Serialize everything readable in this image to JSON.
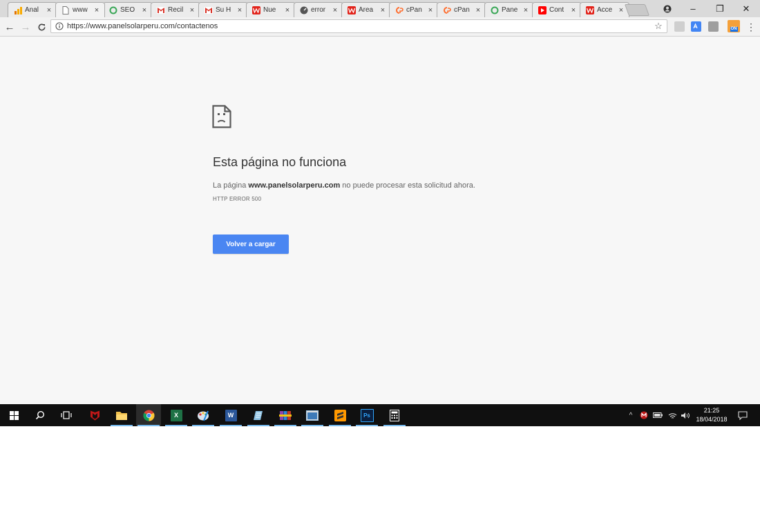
{
  "browser": {
    "tabs": [
      {
        "title": "Anal",
        "favicon": "analytics-icon",
        "color": "#f4b400"
      },
      {
        "title": "www",
        "favicon": "page-icon",
        "color": "#ffffff",
        "active": true
      },
      {
        "title": "SEO",
        "favicon": "green-refresh-icon",
        "color": "#3aa757"
      },
      {
        "title": "Recil",
        "favicon": "gmail-1004-icon",
        "color": "#d93025"
      },
      {
        "title": "Su H",
        "favicon": "gmail-icon",
        "color": "#d93025"
      },
      {
        "title": "Nue",
        "favicon": "w-icon",
        "color": "#e2231a"
      },
      {
        "title": "error",
        "favicon": "gauge-icon",
        "color": "#555555"
      },
      {
        "title": "Área",
        "favicon": "w-icon",
        "color": "#e2231a"
      },
      {
        "title": "cPan",
        "favicon": "cpanel-icon",
        "color": "#ff6c2c"
      },
      {
        "title": "cPan",
        "favicon": "cpanel-icon",
        "color": "#ff6c2c"
      },
      {
        "title": "Pane",
        "favicon": "green-refresh-icon",
        "color": "#3aa757"
      },
      {
        "title": "Cont",
        "favicon": "youtube-icon",
        "color": "#ff0000"
      },
      {
        "title": "Acce",
        "favicon": "w-icon",
        "color": "#e2231a"
      }
    ],
    "tab_close": "×",
    "window_controls": {
      "minimize": "–",
      "restore": "❐",
      "close": "✕"
    },
    "back": "←",
    "forward": "→",
    "reload": "C",
    "url": "https://www.panelsolarperu.com/contactenos",
    "star": "☆",
    "menu": "⋮",
    "extension_badge": "ON"
  },
  "error_page": {
    "heading": "Esta página no funciona",
    "message_prefix": "La página ",
    "domain": "www.panelsolarperu.com",
    "message_suffix": " no puede procesar esta solicitud ahora.",
    "error_code": "HTTP ERROR 500",
    "reload_button": "Volver a cargar"
  },
  "taskbar": {
    "clock_time": "21:25",
    "clock_date": "18/04/2018",
    "excel_letter": "X",
    "word_letter": "W",
    "ps_label": "Ps",
    "tray_up": "^"
  },
  "colors": {
    "reload_button": "#4a86f2",
    "taskbar": "#101010",
    "taskbar_active_underline": "#76b9ed"
  }
}
